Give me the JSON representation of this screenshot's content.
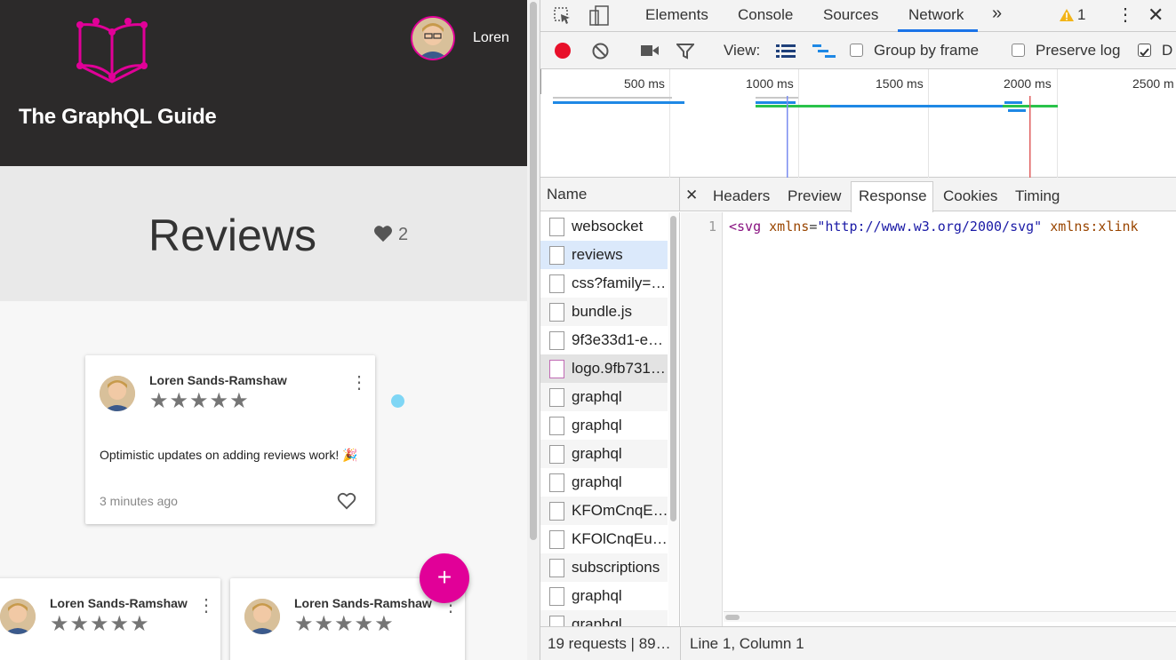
{
  "app": {
    "title": "The GraphQL Guide",
    "user_name": "Loren",
    "page_title": "Reviews",
    "favorites_count": "2",
    "fab_label": "+",
    "accent_color": "#e10098",
    "header_color": "#2c2a2a"
  },
  "reviews": [
    {
      "author": "Loren Sands-Ramshaw",
      "stars": "★★★★★",
      "text": "Optimistic updates on adding reviews work! 🎉",
      "time": "3 minutes ago",
      "rating": 5
    },
    {
      "author": "Loren Sands-Ramshaw",
      "stars": "★★★★★",
      "rating": 5
    },
    {
      "author": "Loren Sands-Ramshaw",
      "stars": "★★★★★",
      "rating": 5
    }
  ],
  "devtools": {
    "tabs": [
      "Elements",
      "Console",
      "Sources",
      "Network"
    ],
    "active_tab": "Network",
    "more_tabs": "»",
    "warning_count": "1",
    "toolbar": {
      "view_label": "View:",
      "group_by_frame": "Group by frame",
      "preserve_log": "Preserve log",
      "disable_cache_trunc": "D"
    },
    "timeline_ticks": [
      "500 ms",
      "1000 ms",
      "1500 ms",
      "2000 ms",
      "2500 m"
    ],
    "name_header": "Name",
    "detail_tabs": [
      "Headers",
      "Preview",
      "Response",
      "Cookies",
      "Timing"
    ],
    "active_detail_tab": "Response",
    "requests": [
      "websocket",
      "reviews",
      "css?family=…",
      "bundle.js",
      "9f3e33d1-e…",
      "logo.9fb731…",
      "graphql",
      "graphql",
      "graphql",
      "graphql",
      "KFOmCnqE…",
      "KFOlCnqEu…",
      "subscriptions",
      "graphql",
      "graphql"
    ],
    "selected_request": "reviews",
    "response": {
      "line_number": "1",
      "tag": "<svg",
      "attr1": "xmlns",
      "val1": "\"http://www.w3.org/2000/svg\"",
      "attr2": "xmlns:xlink"
    },
    "status_left": "19 requests | 89…",
    "status_right": "Line 1, Column 1"
  }
}
